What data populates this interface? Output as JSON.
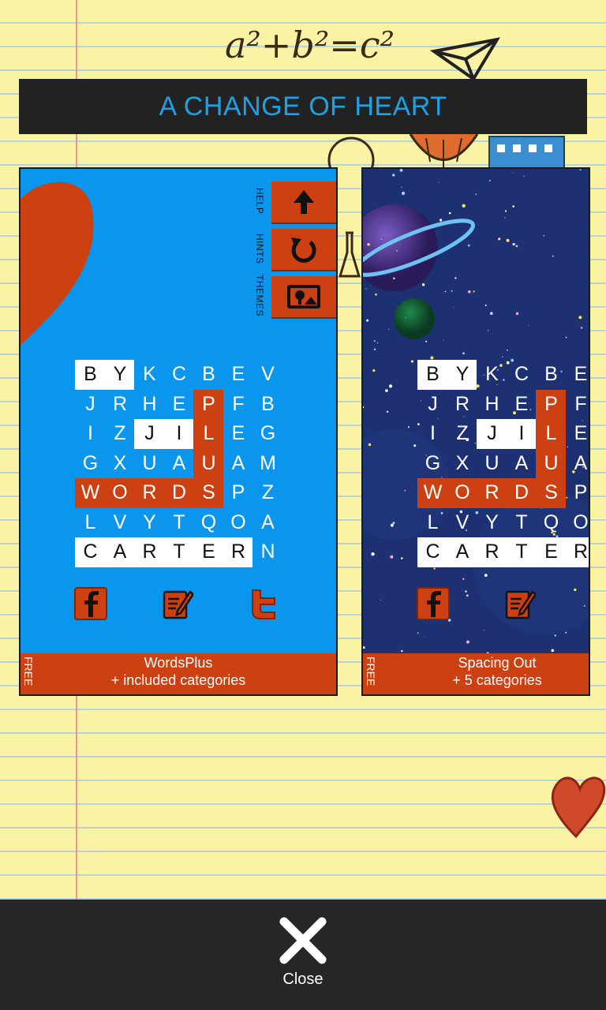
{
  "title": "A CHANGE OF HEART",
  "doodle_text": "a²+b²=c²",
  "cards": [
    {
      "name": "WordsPlus",
      "subtitle": "+ included categories",
      "price": "FREE",
      "side_labels": [
        "HELP",
        "HINTS",
        "THEMES"
      ],
      "background": "#0a96ec",
      "accent": "#cc4011"
    },
    {
      "name": "Spacing Out",
      "subtitle": "+ 5 categories",
      "price": "FREE",
      "background": "#1d3072",
      "accent": "#cc4011"
    }
  ],
  "grid_rows": [
    [
      "B",
      "Y",
      "K",
      "C",
      "B",
      "E",
      "V"
    ],
    [
      "J",
      "R",
      "H",
      "E",
      "P",
      "F",
      "B"
    ],
    [
      "I",
      "Z",
      "J",
      "I",
      "L",
      "E",
      "G"
    ],
    [
      "G",
      "X",
      "U",
      "A",
      "U",
      "A",
      "M"
    ],
    [
      "W",
      "O",
      "R",
      "D",
      "S",
      "P",
      "Z"
    ],
    [
      "L",
      "V",
      "Y",
      "T",
      "Q",
      "O",
      "A"
    ],
    [
      "C",
      "A",
      "R",
      "T",
      "E",
      "R",
      "N"
    ]
  ],
  "icons": {
    "up": "arrow-up-icon",
    "refresh": "refresh-icon",
    "theme": "picture-icon",
    "facebook": "facebook-icon",
    "edit": "edit-icon",
    "twitter": "twitter-icon",
    "close": "close-icon"
  },
  "close_label": "Close",
  "colors": {
    "accent": "#cc4011",
    "banner_text": "#1ea0e6",
    "paper": "#fbf3a4"
  }
}
